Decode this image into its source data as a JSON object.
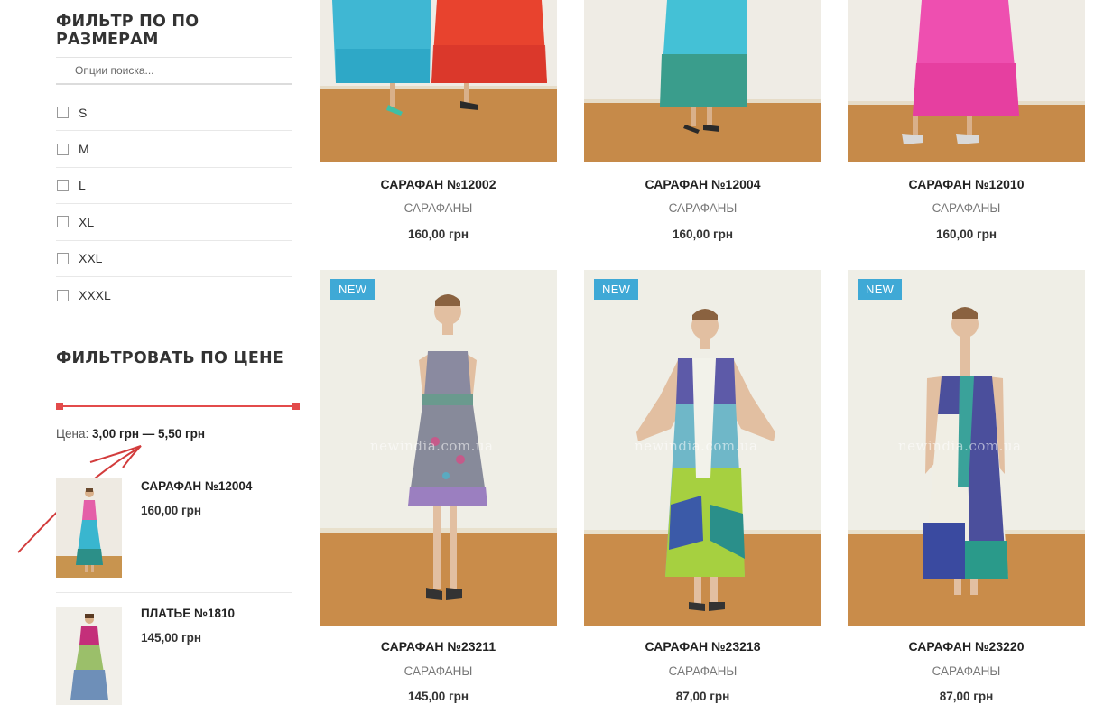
{
  "sidebar": {
    "size_filter": {
      "title": "ФИЛЬТР ПО ПО РАЗМЕРАМ",
      "search_placeholder": "Опции поиска...",
      "sizes": [
        "S",
        "M",
        "L",
        "XL",
        "XXL",
        "XXXL"
      ]
    },
    "price_filter": {
      "title": "ФИЛЬТРОВАТЬ ПО ЦЕНЕ",
      "price_label": "Цена:",
      "price_range": "3,00 грн — 5,50 грн"
    },
    "products": [
      {
        "name": "САРАФАН №12004",
        "price": "160,00 грн"
      },
      {
        "name": "ПЛАТЬЕ №1810",
        "price": "145,00 грн"
      }
    ]
  },
  "grid": {
    "watermark": "newindia.com.ua",
    "products": [
      {
        "title": "САРАФАН №12002",
        "category": "САРАФАНЫ",
        "price": "160,00 грн",
        "badge": ""
      },
      {
        "title": "САРАФАН №12004",
        "category": "САРАФАНЫ",
        "price": "160,00 грн",
        "badge": ""
      },
      {
        "title": "САРАФАН №12010",
        "category": "САРАФАНЫ",
        "price": "160,00 грн",
        "badge": ""
      },
      {
        "title": "САРАФАН №23211",
        "category": "САРАФАНЫ",
        "price": "145,00 грн",
        "badge": "NEW"
      },
      {
        "title": "САРАФАН №23218",
        "category": "САРАФАНЫ",
        "price": "87,00 грн",
        "badge": "NEW"
      },
      {
        "title": "САРАФАН №23220",
        "category": "САРАФАНЫ",
        "price": "87,00 грн",
        "badge": "NEW"
      }
    ]
  },
  "colors": {
    "accent_red": "#e34b4b",
    "badge_blue": "#3fa9d6"
  }
}
